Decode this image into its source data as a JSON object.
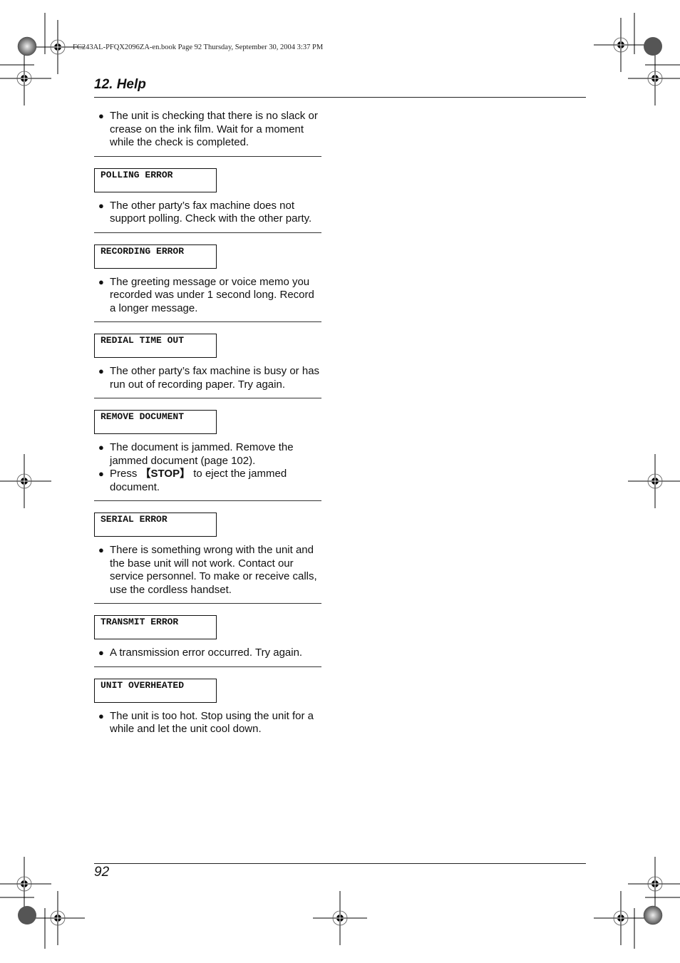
{
  "print_header": "FC243AL-PFQX2096ZA-en.book  Page 92  Thursday, September 30, 2004  3:37 PM",
  "chapter_title": "12. Help",
  "page_number": "92",
  "intro_bullets": [
    "The unit is checking that there is no slack or crease on the ink film. Wait for a moment while the check is completed."
  ],
  "sections": [
    {
      "message": "POLLING ERROR",
      "bullets": [
        "The other party’s fax machine does not support polling. Check with the other party."
      ]
    },
    {
      "message": "RECORDING ERROR",
      "bullets": [
        "The greeting message or voice memo you recorded was under 1 second long. Record a longer message."
      ]
    },
    {
      "message": "REDIAL TIME OUT",
      "bullets": [
        "The other party’s fax machine is busy or has run out of recording paper. Try again."
      ]
    },
    {
      "message": "REMOVE DOCUMENT",
      "bullets": [
        "The document is jammed. Remove the jammed document (page 102).",
        "Press {STOP} to eject the jammed document."
      ],
      "key_label": "【STOP】",
      "bullet2_pre": "Press ",
      "bullet2_post": " to eject the jammed document."
    },
    {
      "message": "SERIAL ERROR",
      "bullets": [
        "There is something wrong with the unit and the base unit will not work. Contact our service personnel. To make or receive calls, use the cordless handset."
      ]
    },
    {
      "message": "TRANSMIT ERROR",
      "bullets": [
        "A transmission error occurred. Try again."
      ]
    },
    {
      "message": "UNIT OVERHEATED",
      "bullets": [
        "The unit is too hot. Stop using the unit for a while and let the unit cool down."
      ]
    }
  ],
  "icons": {
    "bullet": "●",
    "registration_mark": "registration-crosshair-icon",
    "color_target": "starburst-target-icon"
  }
}
